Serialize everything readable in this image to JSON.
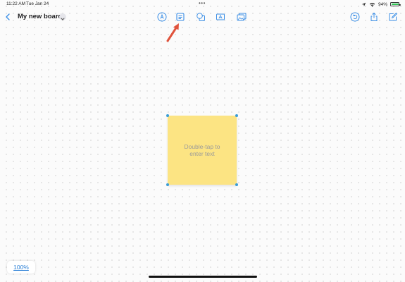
{
  "status": {
    "time": "11:22 AM",
    "date": "Tue Jan 24",
    "battery": "94%",
    "battery_level": 0.94,
    "multitask": "•••"
  },
  "toolbar": {
    "title": "My new board",
    "left": [
      "back-icon",
      "title-menu-chevron-icon"
    ],
    "tools": [
      "pen-icon",
      "sticky-note-icon",
      "shapes-icon",
      "text-box-icon",
      "media-icon"
    ],
    "right": [
      "undo-icon",
      "share-icon",
      "compose-icon"
    ]
  },
  "annotation": {
    "arrow_color": "#e0533c",
    "points_to": "sticky-note-icon"
  },
  "sticky_note": {
    "placeholder": "Double-tap to enter text",
    "color": "#fce483",
    "handle_color": "#3a9dd8"
  },
  "zoom": {
    "label": "100%"
  },
  "colors": {
    "accent": "#3a8ee6"
  }
}
